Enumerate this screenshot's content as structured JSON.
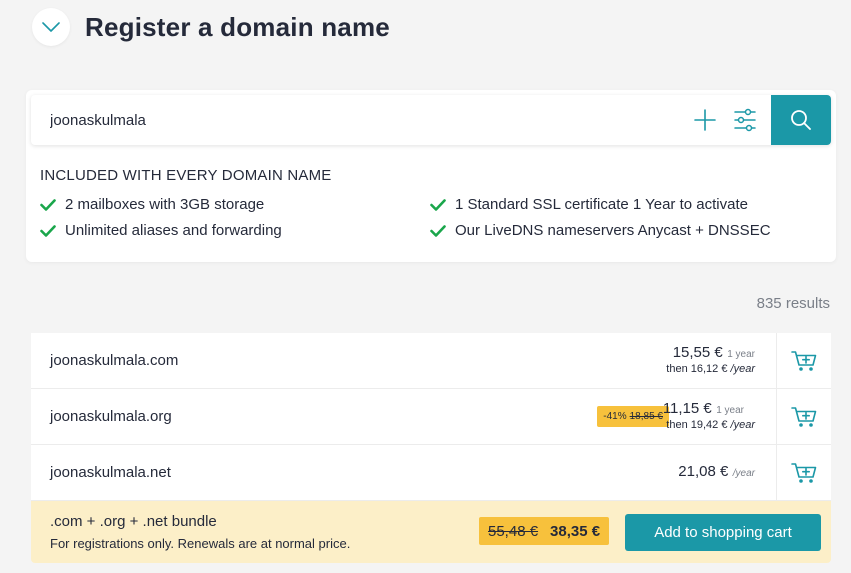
{
  "header": {
    "title": "Register a domain name",
    "collapse_icon": "chevron-down-icon"
  },
  "search": {
    "value": "joonaskulmala",
    "add_icon": "plus-icon",
    "filter_icon": "sliders-icon",
    "search_icon": "search-icon"
  },
  "included": {
    "title": "INCLUDED WITH EVERY DOMAIN NAME",
    "features": [
      "2 mailboxes with 3GB storage",
      "1 Standard SSL certificate 1 Year to activate",
      "Unlimited aliases and forwarding",
      "Our LiveDNS nameservers Anycast + DNSSEC"
    ]
  },
  "results": {
    "count_label": "835 results",
    "rows": [
      {
        "domain": "joonaskulmala.com",
        "price": "15,55 €",
        "period": "1 year",
        "renew_prefix": "then 16,12 €",
        "renew_suffix": "/year"
      },
      {
        "domain": "joonaskulmala.org",
        "price": "11,15 €",
        "period": "1 year",
        "renew_prefix": "then 19,42 €",
        "renew_suffix": "/year",
        "discount": "-41%",
        "old_price": "18,85 €"
      },
      {
        "domain": "joonaskulmala.net",
        "price": "21,08 €",
        "period": "/year"
      }
    ]
  },
  "bundle": {
    "title": ".com + .org + .net bundle",
    "note": "For registrations only. Renewals are at normal price.",
    "old_price": "55,48 €",
    "new_price": "38,35 €",
    "cta": "Add to shopping cart"
  },
  "colors": {
    "accent": "#1b98a7",
    "check": "#1aa64b",
    "badge": "#f7c13c",
    "bundle_bg": "#fcefc8"
  }
}
